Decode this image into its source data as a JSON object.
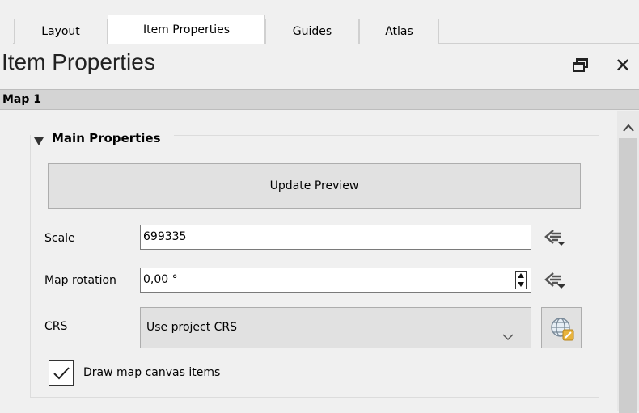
{
  "tabs": [
    {
      "label": "Layout",
      "active": false
    },
    {
      "label": "Item Properties",
      "active": true
    },
    {
      "label": "Guides",
      "active": false
    },
    {
      "label": "Atlas",
      "active": false
    }
  ],
  "dock": {
    "title": "Item Properties",
    "float_icon": "float-window-icon",
    "close_label": "✕"
  },
  "item": {
    "name": "Map 1"
  },
  "main_properties": {
    "title": "Main Properties",
    "collapse_icon": "triangle-down-icon",
    "update_preview_label": "Update Preview",
    "scale": {
      "label": "Scale",
      "value": "699335"
    },
    "map_rotation": {
      "label": "Map rotation",
      "value": "0,00 °"
    },
    "crs": {
      "label": "CRS",
      "selected": "Use project CRS"
    },
    "draw_items": {
      "label": "Draw map canvas items",
      "checked": true
    }
  },
  "icons": {
    "data_defined": "data-defined-override-icon",
    "crs_select": "globe-crs-icon",
    "scroll_up": "chevron-up-icon",
    "dropdown": "chevron-down-icon"
  },
  "colors": {
    "accent": "#e8b33c",
    "item_bar": "#d4d4d4"
  }
}
